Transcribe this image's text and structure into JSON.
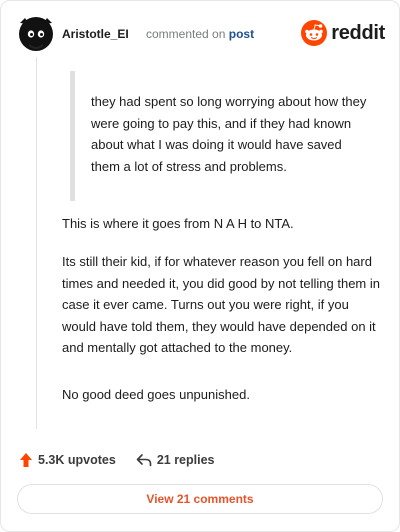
{
  "comment": {
    "username": "Aristotle_EI",
    "meta_prefix": "commented on",
    "meta_link": "post",
    "brand": "reddit",
    "quote": "they had spent so long worrying about how they were going to pay this, and if they had known about what I was doing it would have saved them a lot of stress and problems.",
    "paragraphs": [
      "This is where it goes from N A H to NTA.",
      "Its still their kid, if for whatever reason you fell on hard times and needed it, you did good by not telling them in case it ever came. Turns out you were right, if you would have told them, they would have depended on it and mentally got attached to the money.",
      "No good deed goes unpunished."
    ]
  },
  "actions": {
    "upvotes": "5.3K upvotes",
    "replies": "21 replies"
  },
  "footer": {
    "view_label": "View 21 comments"
  },
  "colors": {
    "accent": "#e8542a",
    "upvote": "#ff4500",
    "link": "#1d4f91"
  },
  "icons": [
    "avatar-icon",
    "reddit-logo-icon",
    "upvote-arrow-icon",
    "reply-arrow-icon"
  ]
}
